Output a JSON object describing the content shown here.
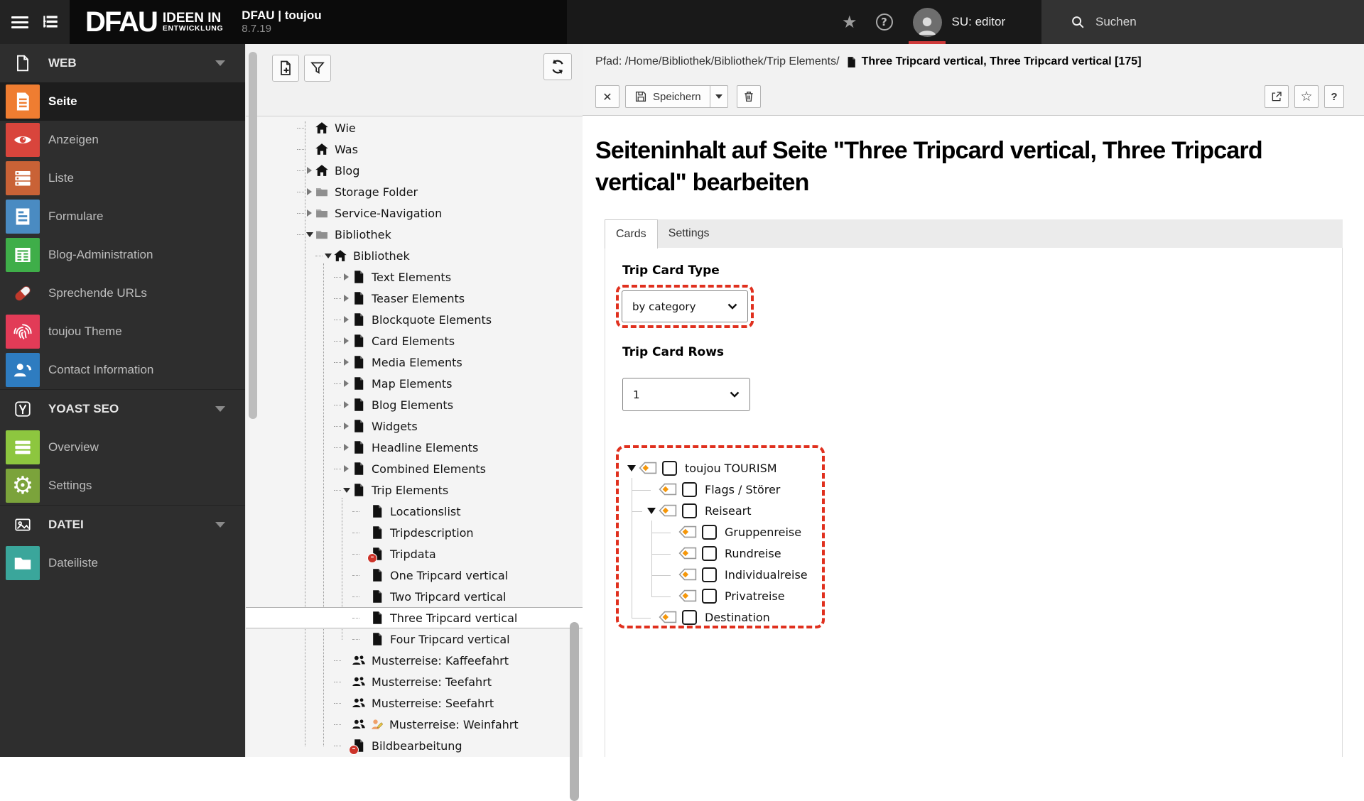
{
  "topbar": {
    "brand": {
      "name": "DFAU",
      "tagline_line1": "IDEEN IN",
      "tagline_line2": "ENTWICKLUNG",
      "product": "DFAU | toujou",
      "version": "8.7.19"
    },
    "user_label": "SU: editor",
    "search_label": "Suchen",
    "avatar_underline_color": "#cf3a3a"
  },
  "module_menu": {
    "sections": [
      {
        "label": "WEB",
        "icon": "document-outline-icon",
        "items": [
          {
            "label": "Seite",
            "icon": "page-lines",
            "color": "#ef7d31",
            "active": true
          },
          {
            "label": "Anzeigen",
            "icon": "eye",
            "color": "#d9453c",
            "active": false
          },
          {
            "label": "Liste",
            "icon": "list-rows",
            "color": "#c96236",
            "active": false
          },
          {
            "label": "Formulare",
            "icon": "form-doc",
            "color": "#4a8bc2",
            "active": false
          },
          {
            "label": "Blog-Administration",
            "icon": "news-grid",
            "color": "#3fae49",
            "active": false
          },
          {
            "label": "Sprechende URLs",
            "icon": "pill",
            "color": "",
            "active": false
          },
          {
            "label": "toujou Theme",
            "icon": "fingerprint",
            "color": "#e23b57",
            "active": false
          },
          {
            "label": "Contact Information",
            "icon": "contact-card",
            "color": "#2e7cc0",
            "active": false
          }
        ]
      },
      {
        "label": "YOAST SEO",
        "icon": "yoast-logo-icon",
        "items": [
          {
            "label": "Overview",
            "icon": "bars",
            "color": "#8dc63f",
            "active": false
          },
          {
            "label": "Settings",
            "icon": "gear",
            "color": "#7ba33b",
            "active": false
          }
        ]
      },
      {
        "label": "DATEI",
        "icon": "image-outline-icon",
        "items": [
          {
            "label": "Dateiliste",
            "icon": "folder-white",
            "color": "#3aa69b",
            "active": false
          }
        ]
      }
    ]
  },
  "page_tree": {
    "toolbar_icons": [
      "new-page-icon",
      "filter-icon",
      "refresh-icon"
    ],
    "items": [
      {
        "label": "Wie",
        "icon": "home",
        "level": 0,
        "expand": "none",
        "selected": false
      },
      {
        "label": "Was",
        "icon": "home",
        "level": 0,
        "expand": "none",
        "selected": false
      },
      {
        "label": "Blog",
        "icon": "home",
        "level": 0,
        "expand": "closed",
        "selected": false
      },
      {
        "label": "Storage Folder",
        "icon": "folder",
        "level": 0,
        "expand": "closed",
        "selected": false
      },
      {
        "label": "Service-Navigation",
        "icon": "folder",
        "level": 0,
        "expand": "closed",
        "selected": false
      },
      {
        "label": "Bibliothek",
        "icon": "folder",
        "level": 0,
        "expand": "open",
        "selected": false
      },
      {
        "label": "Bibliothek",
        "icon": "home",
        "level": 1,
        "expand": "open",
        "selected": false
      },
      {
        "label": "Text Elements",
        "icon": "page",
        "level": 2,
        "expand": "closed",
        "selected": false
      },
      {
        "label": "Teaser Elements",
        "icon": "page",
        "level": 2,
        "expand": "closed",
        "selected": false
      },
      {
        "label": "Blockquote Elements",
        "icon": "page",
        "level": 2,
        "expand": "closed",
        "selected": false
      },
      {
        "label": "Card Elements",
        "icon": "page",
        "level": 2,
        "expand": "closed",
        "selected": false
      },
      {
        "label": "Media Elements",
        "icon": "page",
        "level": 2,
        "expand": "closed",
        "selected": false
      },
      {
        "label": "Map Elements",
        "icon": "page",
        "level": 2,
        "expand": "closed",
        "selected": false
      },
      {
        "label": "Blog Elements",
        "icon": "page",
        "level": 2,
        "expand": "closed",
        "selected": false
      },
      {
        "label": "Widgets",
        "icon": "page",
        "level": 2,
        "expand": "closed",
        "selected": false
      },
      {
        "label": "Headline Elements",
        "icon": "page",
        "level": 2,
        "expand": "closed",
        "selected": false
      },
      {
        "label": "Combined Elements",
        "icon": "page",
        "level": 2,
        "expand": "closed",
        "selected": false
      },
      {
        "label": "Trip Elements",
        "icon": "page",
        "level": 2,
        "expand": "open",
        "selected": false
      },
      {
        "label": "Locationslist",
        "icon": "page",
        "level": 3,
        "expand": "none",
        "selected": false
      },
      {
        "label": "Tripdescription",
        "icon": "page",
        "level": 3,
        "expand": "none",
        "selected": false
      },
      {
        "label": "Tripdata",
        "icon": "page-hidden",
        "level": 3,
        "expand": "none",
        "selected": false
      },
      {
        "label": "One Tripcard vertical",
        "icon": "page",
        "level": 3,
        "expand": "none",
        "selected": false
      },
      {
        "label": "Two Tripcard vertical",
        "icon": "page",
        "level": 3,
        "expand": "none",
        "selected": false
      },
      {
        "label": "Three Tripcard vertical",
        "icon": "page",
        "level": 3,
        "expand": "none",
        "selected": true
      },
      {
        "label": "Four Tripcard vertical",
        "icon": "page",
        "level": 3,
        "expand": "none",
        "selected": false
      },
      {
        "label": "Musterreise: Kaffeefahrt",
        "icon": "users",
        "level": 2,
        "expand": "none",
        "selected": false
      },
      {
        "label": "Musterreise: Teefahrt",
        "icon": "users",
        "level": 2,
        "expand": "none",
        "selected": false
      },
      {
        "label": "Musterreise: Seefahrt",
        "icon": "users",
        "level": 2,
        "expand": "none",
        "selected": false
      },
      {
        "label": "Musterreise: Weinfahrt",
        "icon": "users",
        "level": 2,
        "expand": "none",
        "selected": false,
        "extra": "user-edit"
      },
      {
        "label": "Bildbearbeitung",
        "icon": "page-hidden",
        "level": 2,
        "expand": "none",
        "selected": false
      }
    ]
  },
  "docheader": {
    "path_prefix": "Pfad: /Home/Bibliothek/Bibliothek/Trip Elements/",
    "record_title": "Three Tripcard vertical, Three Tripcard vertical [175]",
    "close_label": "✕",
    "save_label": "Speichern",
    "help_label": "?",
    "star_label": "☆"
  },
  "content": {
    "heading": "Seiteninhalt auf Seite \"Three Tripcard vertical, Three Tripcard vertical\" bearbeiten",
    "tabs": [
      {
        "label": "Cards",
        "active": true
      },
      {
        "label": "Settings",
        "active": false
      }
    ],
    "fields": [
      {
        "label": "Trip Card Type",
        "value": "by category",
        "highlighted": true
      },
      {
        "label": "Trip Card Rows",
        "value": "1",
        "highlighted": false
      }
    ],
    "category_tree": {
      "highlighted": true,
      "items": [
        {
          "label": "toujou TOURISM",
          "level": 0,
          "expanded": true
        },
        {
          "label": "Flags / Störer",
          "level": 1,
          "expanded": false
        },
        {
          "label": "Reiseart",
          "level": 1,
          "expanded": true
        },
        {
          "label": "Gruppenreise",
          "level": 2,
          "expanded": false
        },
        {
          "label": "Rundreise",
          "level": 2,
          "expanded": false
        },
        {
          "label": "Individualreise",
          "level": 2,
          "expanded": false
        },
        {
          "label": "Privatreise",
          "level": 2,
          "expanded": false
        },
        {
          "label": "Destination",
          "level": 1,
          "expanded": false
        }
      ]
    }
  },
  "colors": {
    "highlight_dashed": "#e0301e",
    "tag_orange": "#f5970a",
    "hidden_badge": "#cc3329"
  }
}
